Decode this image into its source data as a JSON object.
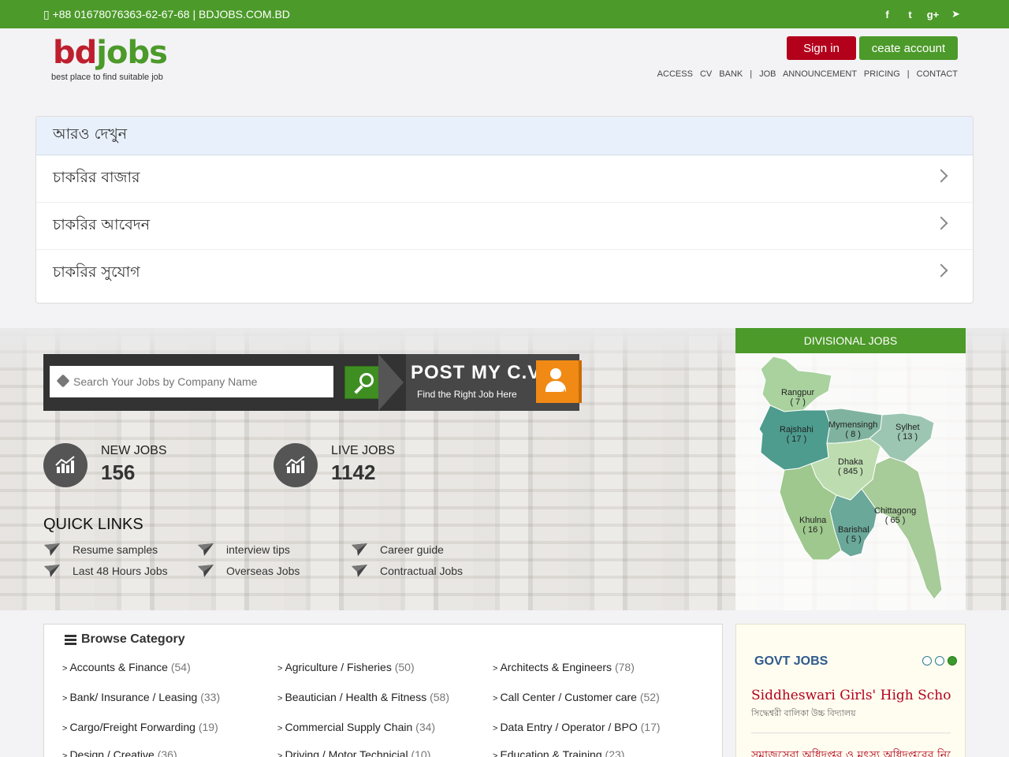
{
  "topbar": {
    "contact": "+88 01678076363-62-67-68 | BDJOBS.COM.BD",
    "social": [
      {
        "icon": "facebook-icon",
        "glyph": "f"
      },
      {
        "icon": "twitter-icon",
        "glyph": "t"
      },
      {
        "icon": "google-plus-icon",
        "glyph": "g+"
      },
      {
        "icon": "location-arrow-icon",
        "glyph": "➤"
      }
    ]
  },
  "header": {
    "logo_bd": "bd",
    "logo_jobs": "jobs",
    "tagline": "best place to find suitable job",
    "signin": "Sign in",
    "create": "ceate account",
    "nav": [
      "ACCESS CV BANK",
      "JOB ANNOUNCEMENT PRICING",
      "CONTACT"
    ]
  },
  "more": {
    "title": "আরও দেখুন",
    "items": [
      "চাকরির বাজার",
      "চাকরির আবেদন",
      "চাকরির সুযোগ"
    ]
  },
  "search": {
    "placeholder": "Search Your Jobs by Company Name",
    "post_title": "POST MY  C.V",
    "post_sub": "Find the Right Job Here"
  },
  "stats": {
    "new_label": "NEW JOBS",
    "new_value": "156",
    "live_label": "LIVE JOBS",
    "live_value": "1142"
  },
  "quick_links": {
    "title": "QUICK LINKS",
    "items": [
      "Resume samples",
      "interview tips",
      "Career guide",
      "Last 48 Hours Jobs",
      "Overseas Jobs",
      "Contractual Jobs"
    ]
  },
  "divisions": {
    "title": "DIVISIONAL JOBS",
    "items": [
      {
        "name": "Rangpur",
        "count": "( 7 )"
      },
      {
        "name": "Rajshahi",
        "count": "( 17 )"
      },
      {
        "name": "Mymensingh",
        "count": "( 8 )"
      },
      {
        "name": "Sylhet",
        "count": "( 13 )"
      },
      {
        "name": "Dhaka",
        "count": "( 845 )"
      },
      {
        "name": "Chittagong",
        "count": "( 65 )"
      },
      {
        "name": "Khulna",
        "count": "( 16 )"
      },
      {
        "name": "Barishal",
        "count": "( 5 )"
      }
    ]
  },
  "browse": {
    "title": "Browse Category",
    "categories": [
      {
        "name": "Accounts & Finance",
        "count": "(54)"
      },
      {
        "name": "Agriculture / Fisheries",
        "count": "(50)"
      },
      {
        "name": "Architects & Engineers",
        "count": "(78)"
      },
      {
        "name": "Bank/ Insurance / Leasing",
        "count": "(33)"
      },
      {
        "name": "Beautician / Health & Fitness",
        "count": "(58)"
      },
      {
        "name": "Call Center / Customer care",
        "count": "(52)"
      },
      {
        "name": "Cargo/Freight Forwarding",
        "count": "(19)"
      },
      {
        "name": "Commercial Supply Chain",
        "count": "(34)"
      },
      {
        "name": "Data Entry / Operator / BPO",
        "count": "(17)"
      },
      {
        "name": "Design / Creative",
        "count": "(36)"
      },
      {
        "name": "Driving / Motor Technicial",
        "count": "(10)"
      },
      {
        "name": "Education & Training",
        "count": "(23)"
      }
    ]
  },
  "govt": {
    "title": "GOVT JOBS",
    "job1": "Siddheswari Girls' High School (SGHS)",
    "job1_sub": "সিদ্ধেশ্বরী বালিকা উচ্চ বিদ্যালয়",
    "job2": "সমাজসেবা অধিদপ্তর ও মৎস্য অধিদপ্তরের নিয়োগ"
  },
  "colors": {
    "brand_green": "#4c9a2a",
    "brand_red": "#b3001b",
    "orange": "#f08a14"
  }
}
